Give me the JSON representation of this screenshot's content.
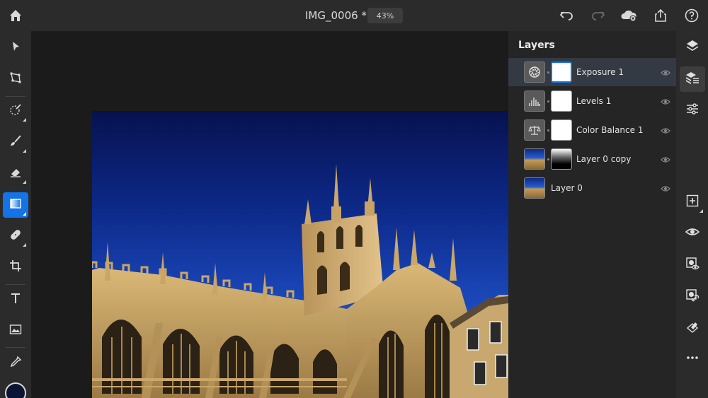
{
  "header": {
    "doc_title": "IMG_0006 *",
    "zoom": "43%"
  },
  "layers_panel": {
    "title": "Layers",
    "layers": [
      {
        "name": "Exposure 1",
        "type": "adjustment",
        "icon": "exposure-icon",
        "mask": "white",
        "selected": true
      },
      {
        "name": "Levels 1",
        "type": "adjustment",
        "icon": "levels-icon",
        "mask": "white",
        "selected": false
      },
      {
        "name": "Color Balance 1",
        "type": "adjustment",
        "icon": "color-balance-icon",
        "mask": "white",
        "selected": false
      },
      {
        "name": "Layer 0 copy",
        "type": "pixel",
        "icon": "image-thumbnail",
        "mask": "gradient",
        "selected": false
      },
      {
        "name": "Layer 0",
        "type": "pixel",
        "icon": "image-thumbnail",
        "mask": "none",
        "selected": false
      }
    ]
  },
  "colors": {
    "accent": "#1473e6",
    "panel": "#252525",
    "toolbar": "#2b2b2b",
    "foreground_color": "#0a1536"
  }
}
